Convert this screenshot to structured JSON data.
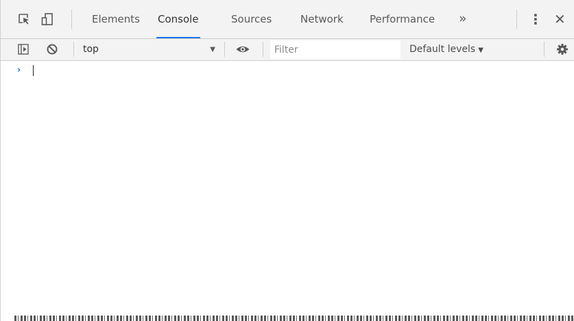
{
  "tabbar": {
    "tabs": [
      {
        "label": "Elements",
        "active": false
      },
      {
        "label": "Console",
        "active": true
      },
      {
        "label": "Sources",
        "active": false
      },
      {
        "label": "Network",
        "active": false
      },
      {
        "label": "Performance",
        "active": false
      }
    ],
    "more_tabs": "»",
    "kebab": "⋮",
    "close": "✕"
  },
  "toolbar": {
    "context": "top",
    "context_arrow": "▼",
    "filter_placeholder": "Filter",
    "levels": "Default levels",
    "levels_arrow": "▼"
  },
  "console": {
    "prompt": "›"
  },
  "colors": {
    "accent": "#1a73e8",
    "toolbar_bg": "#f3f3f3",
    "border": "#cccccc"
  },
  "icons": {
    "inspect": "inspect-element-icon",
    "device": "device-toolbar-icon",
    "sidebar": "show-sidebar-icon",
    "clear": "clear-console-icon",
    "eye": "live-expression-icon",
    "settings": "gear-icon"
  }
}
